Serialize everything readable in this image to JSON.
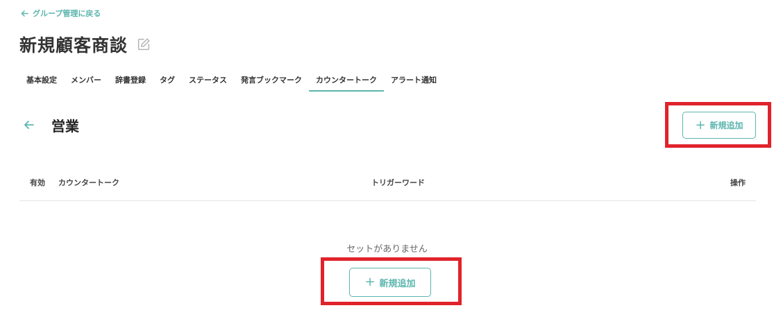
{
  "nav": {
    "back_label": "グループ管理に戻る"
  },
  "page": {
    "title": "新規顧客商談"
  },
  "tabs": [
    {
      "label": "基本設定",
      "active": false
    },
    {
      "label": "メンバー",
      "active": false
    },
    {
      "label": "辞書登録",
      "active": false
    },
    {
      "label": "タグ",
      "active": false
    },
    {
      "label": "ステータス",
      "active": false
    },
    {
      "label": "発言ブックマーク",
      "active": false
    },
    {
      "label": "カウンタートーク",
      "active": true
    },
    {
      "label": "アラート通知",
      "active": false
    }
  ],
  "section": {
    "title": "営業"
  },
  "buttons": {
    "add_plus": "+",
    "add_label": "新規追加"
  },
  "table": {
    "columns": {
      "enabled": "有効",
      "counter_talk": "カウンタートーク",
      "trigger_word": "トリガーワード",
      "actions": "操作"
    },
    "rows": []
  },
  "empty_state": {
    "message": "セットがありません"
  },
  "icons": {
    "back": "arrow-left-icon",
    "edit": "pencil-edit-icon",
    "add": "plus-icon"
  },
  "colors": {
    "accent": "#5bb5ae",
    "highlight": "#e0232b",
    "text": "#333333"
  }
}
